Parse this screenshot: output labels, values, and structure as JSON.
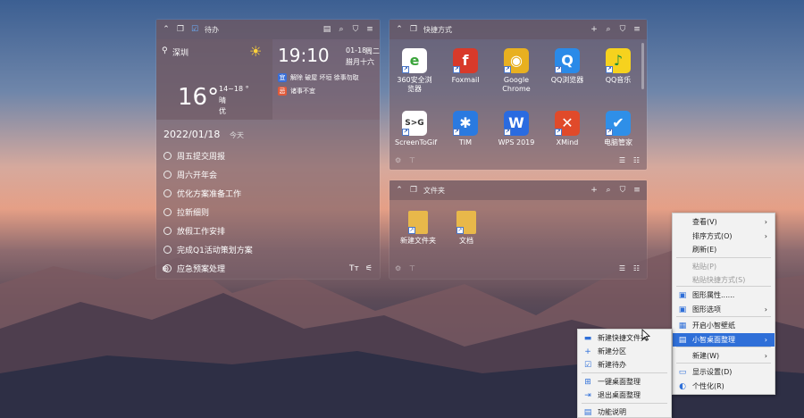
{
  "colors": {
    "accent": "#2f6fd8",
    "menu_bg": "#f2f2f2"
  },
  "todo_panel": {
    "title": "待办",
    "header_icons": [
      "chevron-up-icon",
      "copy-icon",
      "checkbox-icon",
      "calendar-icon",
      "search-icon",
      "shirt-icon",
      "menu-icon"
    ],
    "weather": {
      "city": "深圳",
      "temp": "16°",
      "range": "14~18 °",
      "desc": "晴",
      "aqi": "优"
    },
    "clock": {
      "time": "19:10",
      "date": "01-18",
      "weekday": "周二",
      "lunar": "腊月十六"
    },
    "almanac": {
      "good_icon": "宜",
      "good": "解除 破屋 坏垣 徐事勿取",
      "bad_icon": "忌",
      "bad": "诸事不宜"
    },
    "date": "2022/01/18",
    "today_label": "今天",
    "items": [
      "周五提交周报",
      "周六开年会",
      "优化方案准备工作",
      "拉新细则",
      "放假工作安排",
      "完成Q1活动策划方案",
      "应急预案处理"
    ],
    "footer_left_icon": "add-circle-icon",
    "footer_icons": [
      "text-format-icon",
      "filter-icon"
    ]
  },
  "shortcuts_panel": {
    "title": "快捷方式",
    "apps": [
      {
        "label": "360安全浏览器",
        "icon": "e",
        "color": "#3aa43a",
        "bg": "#fff"
      },
      {
        "label": "Foxmail",
        "icon": "f",
        "color": "#fff",
        "bg": "#d83a2a"
      },
      {
        "label": "Google Chrome",
        "icon": "◉",
        "color": "#fff",
        "bg": "#e8b020"
      },
      {
        "label": "QQ浏览器",
        "icon": "Q",
        "color": "#fff",
        "bg": "#2a8ae8"
      },
      {
        "label": "QQ音乐",
        "icon": "♪",
        "color": "#1f8f3a",
        "bg": "#f6d21e"
      },
      {
        "label": "ScreenToGif",
        "icon": "S>G",
        "color": "#333",
        "bg": "#fff"
      },
      {
        "label": "TIM",
        "icon": "✱",
        "color": "#fff",
        "bg": "#2a7ae0"
      },
      {
        "label": "WPS 2019",
        "icon": "W",
        "color": "#fff",
        "bg": "#2a6be0"
      },
      {
        "label": "XMind",
        "icon": "✕",
        "color": "#fff",
        "bg": "#e04a2a"
      },
      {
        "label": "电脑管家",
        "icon": "✔",
        "color": "#fff",
        "bg": "#2f8fe8"
      }
    ]
  },
  "folder_panel": {
    "title": "文件夹",
    "items": [
      {
        "label": "新建文件夹"
      },
      {
        "label": "文档"
      }
    ]
  },
  "main_menu": {
    "items": [
      {
        "label": "查看(V)",
        "arrow": "›",
        "disabled": false,
        "icon": ""
      },
      {
        "label": "排序方式(O)",
        "arrow": "›",
        "disabled": false,
        "icon": ""
      },
      {
        "label": "刷新(E)",
        "arrow": "",
        "disabled": false,
        "icon": ""
      },
      {
        "label": "粘贴(P)",
        "arrow": "",
        "disabled": true,
        "icon": ""
      },
      {
        "label": "粘贴快捷方式(S)",
        "arrow": "",
        "disabled": true,
        "icon": ""
      },
      {
        "label": "图形属性......",
        "arrow": "",
        "disabled": false,
        "icon": "▣"
      },
      {
        "label": "图形选项",
        "arrow": "›",
        "disabled": false,
        "icon": "▣"
      },
      {
        "label": "开启小智壁纸",
        "arrow": "",
        "disabled": false,
        "icon": "▦"
      },
      {
        "label": "小智桌面整理",
        "arrow": "›",
        "disabled": false,
        "icon": "▤"
      },
      {
        "label": "新建(W)",
        "arrow": "›",
        "disabled": false,
        "icon": ""
      },
      {
        "label": "显示设置(D)",
        "arrow": "",
        "disabled": false,
        "icon": "▭"
      },
      {
        "label": "个性化(R)",
        "arrow": "",
        "disabled": false,
        "icon": "◐"
      }
    ]
  },
  "sub_menu": {
    "items": [
      {
        "label": "新建快捷文件夹",
        "icon": "▬"
      },
      {
        "label": "新建分区",
        "icon": "+"
      },
      {
        "label": "新建待办",
        "icon": "☑"
      },
      {
        "label": "一键桌面整理",
        "icon": "⊞"
      },
      {
        "label": "退出桌面整理",
        "icon": "⇥"
      },
      {
        "label": "功能说明",
        "icon": "▤"
      }
    ]
  }
}
